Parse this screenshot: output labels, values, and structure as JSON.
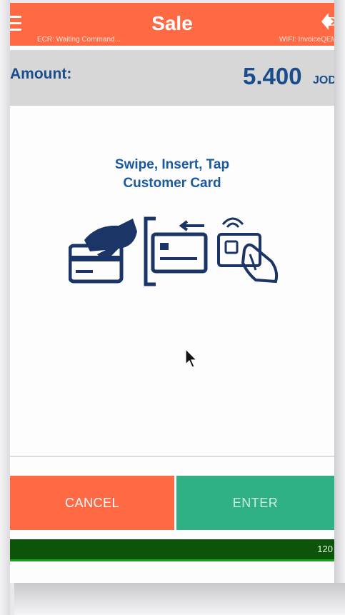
{
  "header": {
    "title": "Sale",
    "ecr_status": "ECR: Waiting Command...",
    "wifi_status": "WIFI: InvoiceQEM"
  },
  "amount": {
    "label": "Amount:",
    "value": "5.400",
    "currency": "JOD"
  },
  "prompt": {
    "line1": "Swipe, Insert, Tap",
    "line2": "Customer Card"
  },
  "icons": [
    "menu-icon",
    "back-icon",
    "swipe-card-icon",
    "insert-card-icon",
    "tap-card-icon",
    "cursor-icon"
  ],
  "buttons": {
    "cancel": "CANCEL",
    "enter": "ENTER"
  },
  "timer": {
    "value": "120"
  },
  "colors": {
    "header": "#ff6a45",
    "amount_text": "#1a4d8c",
    "cancel": "#ff6a45",
    "enter": "#2fb085",
    "progress": "#0b5409"
  }
}
